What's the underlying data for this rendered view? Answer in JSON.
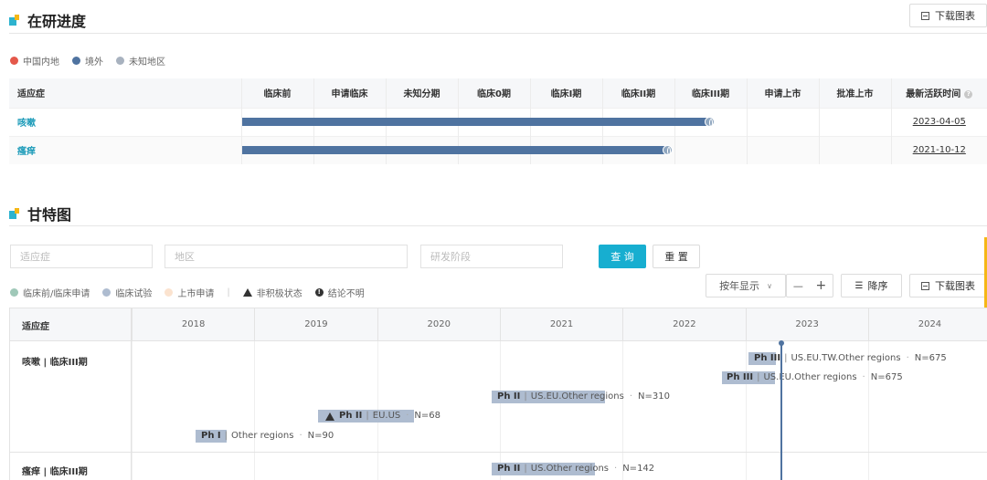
{
  "section1": {
    "title": "在研进度",
    "download_label": "下载图表",
    "legend": [
      {
        "label": "中国内地",
        "color": "#e4584a"
      },
      {
        "label": "境外",
        "color": "#4f73a0"
      },
      {
        "label": "未知地区",
        "color": "#a8b2bf"
      }
    ],
    "table": {
      "headers": [
        "适应症",
        "临床前",
        "申请临床",
        "未知分期",
        "临床0期",
        "临床I期",
        "临床II期",
        "临床III期",
        "申请上市",
        "批准上市",
        "最新活跃时间"
      ],
      "rows": [
        {
          "indication": "咳嗽",
          "date": "2023-04-05",
          "stage_reached": "临床III期",
          "region": "境外"
        },
        {
          "indication": "瘙痒",
          "date": "2021-10-12",
          "stage_reached": "临床III期",
          "region": "境外"
        }
      ]
    }
  },
  "section2": {
    "title": "甘特图",
    "filters": {
      "indication_placeholder": "适应症",
      "region_placeholder": "地区",
      "stage_placeholder": "研发阶段"
    },
    "query_label": "查 询",
    "reset_label": "重 置",
    "legend": [
      {
        "label": "临床前/临床申请",
        "color": "#9fc8b8"
      },
      {
        "label": "临床试验",
        "color": "#aebcd0"
      },
      {
        "label": "上市申请",
        "color": "#fbe3cf"
      }
    ],
    "legend_symbols": {
      "inactive": "非积极状态",
      "unknown": "结论不明"
    },
    "view_select": "按年显示",
    "zoom_out": "—",
    "zoom_in": "+",
    "sort_label": "降序",
    "download_label": "下载图表",
    "gantt": {
      "label_header": "适应症",
      "years": [
        "2018",
        "2019",
        "2020",
        "2021",
        "2022",
        "2023",
        "2024"
      ],
      "rows": [
        {
          "label": "咳嗽 | 临床III期",
          "trials": [
            {
              "phase": "Ph III",
              "regions": "US.EU.TW.Other regions",
              "n": "N=675"
            },
            {
              "phase": "Ph III",
              "regions": "US.EU.Other regions",
              "n": "N=675"
            },
            {
              "phase": "Ph II",
              "regions": "US.EU.Other regions",
              "n": "N=310"
            },
            {
              "phase": "Ph II",
              "regions": "EU.US",
              "n": "N=68",
              "inactive": true
            },
            {
              "phase": "Ph I",
              "regions": "Other regions",
              "n": "N=90"
            }
          ]
        },
        {
          "label": "瘙痒 | 临床III期",
          "trials": [
            {
              "phase": "Ph II",
              "regions": "US.Other regions",
              "n": "N=142"
            }
          ]
        }
      ]
    }
  }
}
